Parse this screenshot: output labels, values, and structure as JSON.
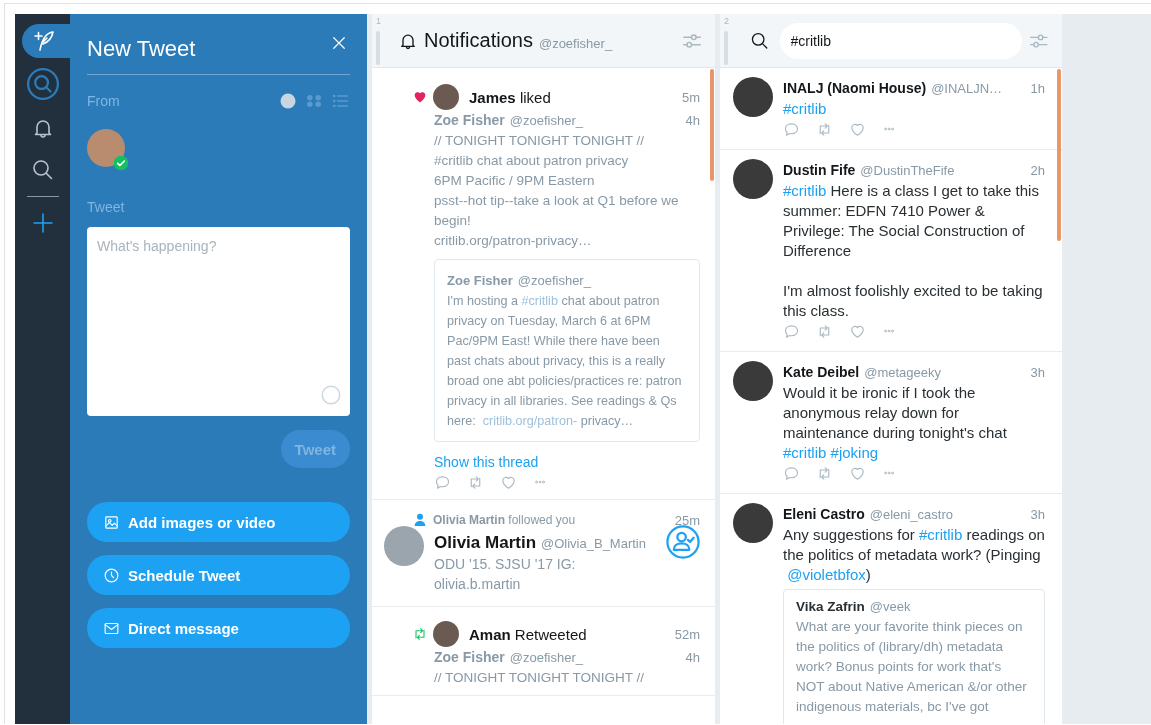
{
  "nav": [
    {
      "kind": "compose",
      "selected": true
    },
    {
      "kind": "account",
      "selected": false
    },
    {
      "kind": "notifications",
      "selected": false
    },
    {
      "kind": "search",
      "selected": false
    },
    {
      "kind": "add",
      "selected": false
    }
  ],
  "compose": {
    "title": "New Tweet",
    "from_label": "From",
    "account_views": [
      {
        "kind": "single",
        "selected": true
      },
      {
        "kind": "grid",
        "selected": false
      },
      {
        "kind": "list",
        "selected": false
      }
    ],
    "account_checked": true,
    "tweet_label": "Tweet",
    "placeholder": "What's happening?",
    "send_button": {
      "label": "Tweet",
      "disabled": true
    },
    "actions": [
      {
        "kind": "media",
        "label": "Add images or video"
      },
      {
        "kind": "schedule",
        "label": "Schedule Tweet"
      },
      {
        "kind": "message",
        "label": "Direct message"
      }
    ]
  },
  "columns": [
    {
      "kind": "notifications",
      "number": "1",
      "title": "Notifications",
      "account": "@zoefisher_",
      "items": [
        {
          "kind": "like",
          "actor": "James",
          "action": "liked",
          "time": "5m",
          "tweet": {
            "name": "Zoe Fisher",
            "handle": "@zoefisher_",
            "time": "4h",
            "body": [
              {
                "kind": "text",
                "text": "// TONIGHT TONIGHT TONIGHT //\n#critlib chat about patron privacy\n6PM Pacific / 9PM Eastern\npsst--hot tip--take a look at Q1 before we begin!\ncritlib.org/patron-privacy…"
              }
            ],
            "quote": {
              "name": "Zoe Fisher",
              "handle": "@zoefisher_",
              "body": [
                {
                  "kind": "text",
                  "text": "I'm hosting a "
                },
                {
                  "kind": "hashtag",
                  "text": "#critlib"
                },
                {
                  "kind": "text",
                  "text": " chat about patron privacy on Tuesday, March 6 at 6PM Pac/9PM East! While there have been past chats about privacy, this is a really broad one abt policies/practices re: patron privacy in all libraries. See readings & Qs here: "
                },
                {
                  "kind": "url",
                  "text": "critlib.org/patron-"
                },
                {
                  "kind": "text",
                  "text": " privacy…"
                }
              ]
            }
          },
          "thread_link": "Show this thread"
        },
        {
          "kind": "follow",
          "actor": "Olivia Martin",
          "action": "followed you",
          "time": "25m",
          "user": {
            "name": "Olivia Martin",
            "handle": "@Olivia_B_Martin",
            "bio": "ODU '15. SJSU '17 IG: olivia.b.martin"
          }
        },
        {
          "kind": "retweet",
          "actor": "Aman",
          "action": "Retweeted",
          "time": "52m",
          "tweet": {
            "name": "Zoe Fisher",
            "handle": "@zoefisher_",
            "time": "4h",
            "body": [
              {
                "kind": "text",
                "text": "// TONIGHT TONIGHT TONIGHT //"
              }
            ]
          }
        }
      ]
    },
    {
      "kind": "search",
      "number": "2",
      "query": "#critlib",
      "items": [
        {
          "kind": "tweet",
          "tweet": {
            "name": "INALJ (Naomi House)",
            "handle": "@INALJN…",
            "time": "1h",
            "body": [
              {
                "kind": "hashtag",
                "text": "#critlib"
              }
            ]
          }
        },
        {
          "kind": "tweet",
          "tweet": {
            "name": "Dustin Fife",
            "handle": "@DustinTheFife",
            "time": "2h",
            "body": [
              {
                "kind": "hashtag",
                "text": "#critlib"
              },
              {
                "kind": "text",
                "text": "  Here is a class I get to take this summer: EDFN 7410 Power & Privilege: The Social Construction of Difference\n\nI'm almost foolishly excited to be taking this class."
              }
            ]
          }
        },
        {
          "kind": "tweet",
          "tweet": {
            "name": "Kate Deibel",
            "handle": "@metageeky",
            "time": "3h",
            "body": [
              {
                "kind": "text",
                "text": "Would it be ironic if I took the anonymous relay down for maintenance during tonight's chat "
              },
              {
                "kind": "hashtag",
                "text": "#critlib"
              },
              {
                "kind": "hashtag",
                "text": "#joking"
              }
            ]
          }
        },
        {
          "kind": "tweet",
          "tweet": {
            "name": "Eleni Castro",
            "handle": "@eleni_castro",
            "time": "3h",
            "body": [
              {
                "kind": "text",
                "text": "Any suggestions for "
              },
              {
                "kind": "hashtag",
                "text": "#critlib"
              },
              {
                "kind": "text",
                "text": " readings on the politics of metadata  work? (Pinging "
              },
              {
                "kind": "mention",
                "text": "@violetbfox"
              },
              {
                "kind": "text",
                "text": ")"
              }
            ],
            "quote": {
              "name": "Vika Zafrin",
              "handle": "@veek",
              "body": [
                {
                  "kind": "text",
                  "text": "What are your favorite think pieces on the politics of (library/dh) metadata work? Bonus points for work that's NOT about Native American &/or other indigenous materials, bc I've got"
                }
              ]
            }
          }
        }
      ]
    }
  ]
}
